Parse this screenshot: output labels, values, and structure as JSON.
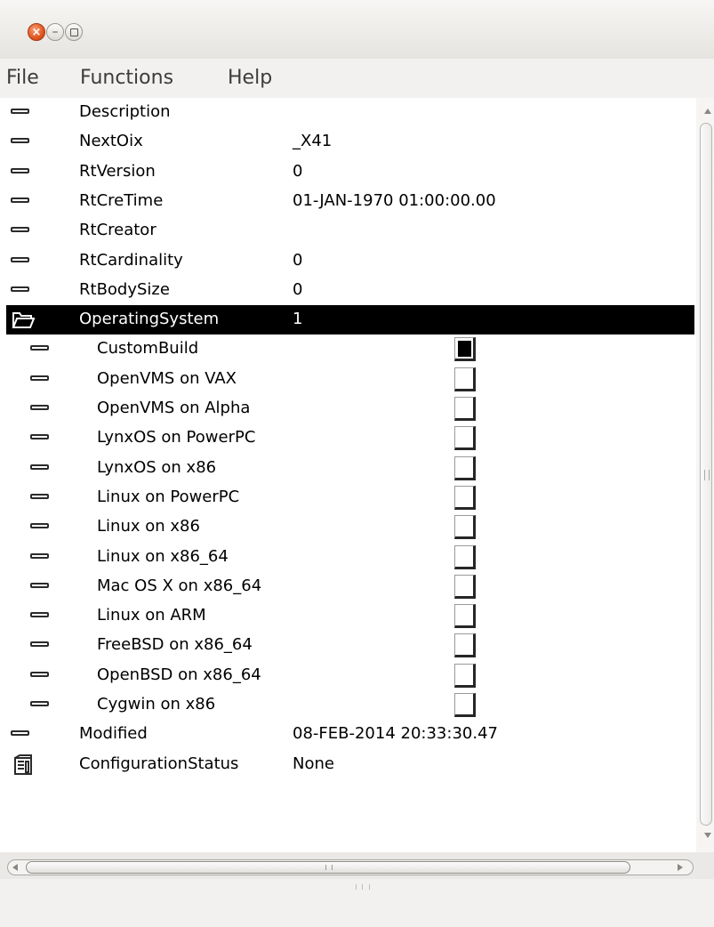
{
  "window": {
    "close_glyph": "×",
    "minimize_glyph": "–"
  },
  "menubar": {
    "items": [
      {
        "label": "File"
      },
      {
        "label": "Functions"
      },
      {
        "label": "Help"
      }
    ]
  },
  "tree": {
    "selected_color": "#000000",
    "rows": [
      {
        "name": "Description",
        "value": "",
        "icon": "attribute-icon"
      },
      {
        "name": "NextOix",
        "value": "_X41",
        "icon": "attribute-icon"
      },
      {
        "name": "RtVersion",
        "value": "0",
        "icon": "attribute-icon"
      },
      {
        "name": "RtCreTime",
        "value": "01-JAN-1970 01:00:00.00",
        "icon": "attribute-icon"
      },
      {
        "name": "RtCreator",
        "value": "",
        "icon": "attribute-icon"
      },
      {
        "name": "RtCardinality",
        "value": "0",
        "icon": "attribute-icon"
      },
      {
        "name": "RtBodySize",
        "value": "0",
        "icon": "attribute-icon"
      },
      {
        "name": "OperatingSystem",
        "value": "1",
        "icon": "open-folder-icon",
        "selected": true
      },
      {
        "name": "CustomBuild",
        "checked": true,
        "icon": "attribute-icon"
      },
      {
        "name": "OpenVMS on VAX",
        "checked": false,
        "icon": "attribute-icon"
      },
      {
        "name": "OpenVMS on Alpha",
        "checked": false,
        "icon": "attribute-icon"
      },
      {
        "name": "LynxOS on PowerPC",
        "checked": false,
        "icon": "attribute-icon"
      },
      {
        "name": "LynxOS on x86",
        "checked": false,
        "icon": "attribute-icon"
      },
      {
        "name": "Linux on PowerPC",
        "checked": false,
        "icon": "attribute-icon"
      },
      {
        "name": "Linux on x86",
        "checked": false,
        "icon": "attribute-icon"
      },
      {
        "name": "Linux on x86_64",
        "checked": false,
        "icon": "attribute-icon"
      },
      {
        "name": "Mac OS X on x86_64",
        "checked": false,
        "icon": "attribute-icon"
      },
      {
        "name": "Linux on ARM",
        "checked": false,
        "icon": "attribute-icon"
      },
      {
        "name": "FreeBSD on x86_64",
        "checked": false,
        "icon": "attribute-icon"
      },
      {
        "name": "OpenBSD on x86_64",
        "checked": false,
        "icon": "attribute-icon"
      },
      {
        "name": "Cygwin on x86",
        "checked": false,
        "icon": "attribute-icon"
      },
      {
        "name": "Modified",
        "value": "08-FEB-2014 20:33:30.47",
        "icon": "attribute-icon"
      },
      {
        "name": "ConfigurationStatus",
        "value": "None",
        "icon": "object-icon"
      }
    ]
  }
}
